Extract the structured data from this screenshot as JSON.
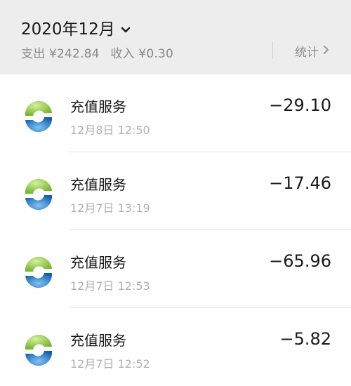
{
  "header": {
    "month_label": "2020年12月",
    "summary_expense": "支出 ¥242.84",
    "summary_income": "收入 ¥0.30",
    "stats_label": "统计"
  },
  "transactions": [
    {
      "title": "充值服务",
      "time": "12月8日 12:50",
      "amount": "−29.10"
    },
    {
      "title": "充值服务",
      "time": "12月7日 13:19",
      "amount": "−17.46"
    },
    {
      "title": "充值服务",
      "time": "12月7日 12:53",
      "amount": "−65.96"
    },
    {
      "title": "充值服务",
      "time": "12月7日 12:52",
      "amount": "−5.82"
    }
  ],
  "colors": {
    "header_bg": "#ededed",
    "logo_green": "#8cc63f",
    "logo_blue": "#1f74c4"
  },
  "icons": {
    "month_dropdown": "chevron-down-icon",
    "stats_arrow": "chevron-right-icon",
    "merchant_logo": "merchant-logo-icon"
  }
}
